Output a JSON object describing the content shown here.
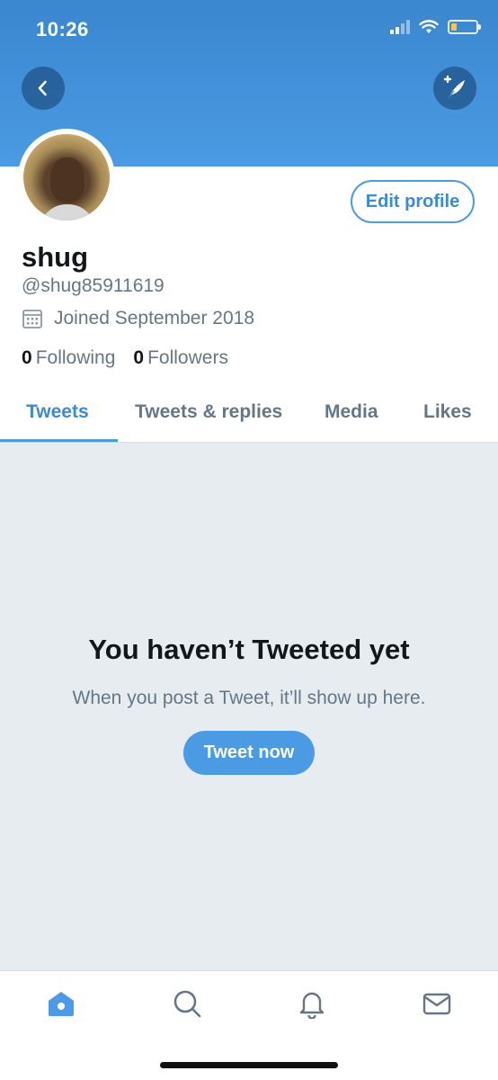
{
  "status_bar": {
    "time": "10:26"
  },
  "header": {
    "back_icon": "chevron-left-icon",
    "compose_icon": "compose-feather-icon"
  },
  "profile": {
    "edit_label": "Edit profile",
    "name": "shug",
    "handle": "@shug85911619",
    "joined": "Joined September 2018",
    "following_count": "0",
    "following_label": "Following",
    "followers_count": "0",
    "followers_label": "Followers"
  },
  "tabs": [
    {
      "label": "Tweets",
      "active": true
    },
    {
      "label": "Tweets & replies",
      "active": false
    },
    {
      "label": "Media",
      "active": false
    },
    {
      "label": "Likes",
      "active": false
    }
  ],
  "empty_state": {
    "title": "You haven’t Tweeted yet",
    "subtitle": "When you post a Tweet, it’ll show up here.",
    "button": "Tweet now"
  },
  "tabbar": [
    {
      "icon": "home-icon",
      "active": true
    },
    {
      "icon": "search-icon",
      "active": false
    },
    {
      "icon": "notifications-bell-icon",
      "active": false
    },
    {
      "icon": "messages-envelope-icon",
      "active": false
    }
  ],
  "colors": {
    "accent": "#4a9be3",
    "text": "#14171a",
    "muted": "#657786",
    "background_gray": "#e6ecf0"
  }
}
